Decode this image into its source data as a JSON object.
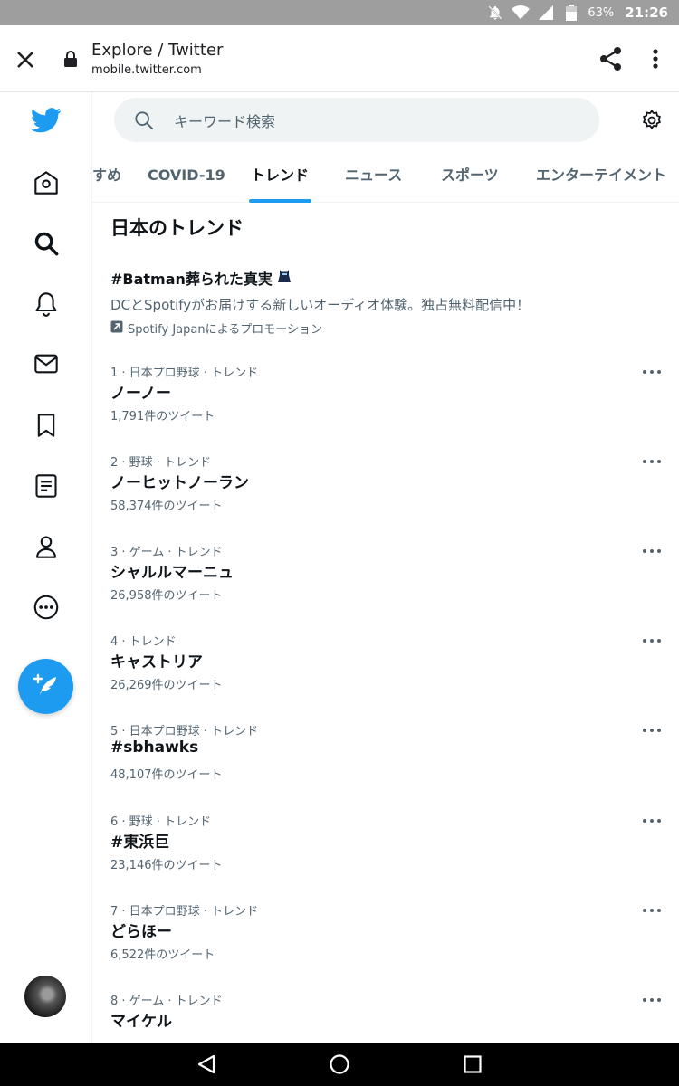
{
  "status_bar": {
    "battery": "63%",
    "time": "21:26"
  },
  "browser": {
    "title": "Explore / Twitter",
    "url": "mobile.twitter.com"
  },
  "search": {
    "placeholder": "キーワード検索"
  },
  "tabs": [
    {
      "label": "すめ"
    },
    {
      "label": "COVID-19"
    },
    {
      "label": "トレンド",
      "active": true
    },
    {
      "label": "ニュース"
    },
    {
      "label": "スポーツ"
    },
    {
      "label": "エンターテイメント"
    }
  ],
  "section_title": "日本のトレンド",
  "promoted": {
    "title": "#Batman葬られた真実",
    "description": "DCとSpotifyがお届けする新しいオーディオ体験。独占無料配信中！",
    "promoted_by": "Spotify Japanによるプロモーション"
  },
  "trends": [
    {
      "meta": "1 · 日本プロ野球 · トレンド",
      "name": "ノーノー",
      "count": "1,791件のツイート"
    },
    {
      "meta": "2 · 野球 · トレンド",
      "name": "ノーヒットノーラン",
      "count": "58,374件のツイート"
    },
    {
      "meta": "3 · ゲーム · トレンド",
      "name": "シャルルマーニュ",
      "count": "26,958件のツイート"
    },
    {
      "meta": "4 · トレンド",
      "name": "キャストリア",
      "count": "26,269件のツイート"
    },
    {
      "meta": "5 · 日本プロ野球 · トレンド",
      "name": "#sbhawks",
      "count": "48,107件のツイート"
    },
    {
      "meta": "6 · 野球 · トレンド",
      "name": "#東浜巨",
      "count": "23,146件のツイート"
    },
    {
      "meta": "7 · 日本プロ野球 · トレンド",
      "name": "どらほー",
      "count": "6,522件のツイート"
    },
    {
      "meta": "8 · ゲーム · トレンド",
      "name": "マイケル",
      "count": ""
    }
  ],
  "colors": {
    "accent": "#1d9bf0",
    "text": "#0f1419",
    "secondary": "#536471"
  },
  "icons": [
    "twitter-logo-icon",
    "home-icon",
    "explore-icon",
    "notifications-icon",
    "messages-icon",
    "bookmarks-icon",
    "lists-icon",
    "profile-icon",
    "more-icon",
    "compose-icon",
    "search-icon",
    "settings-icon",
    "share-icon",
    "overflow-menu-icon",
    "close-icon",
    "lock-icon"
  ]
}
